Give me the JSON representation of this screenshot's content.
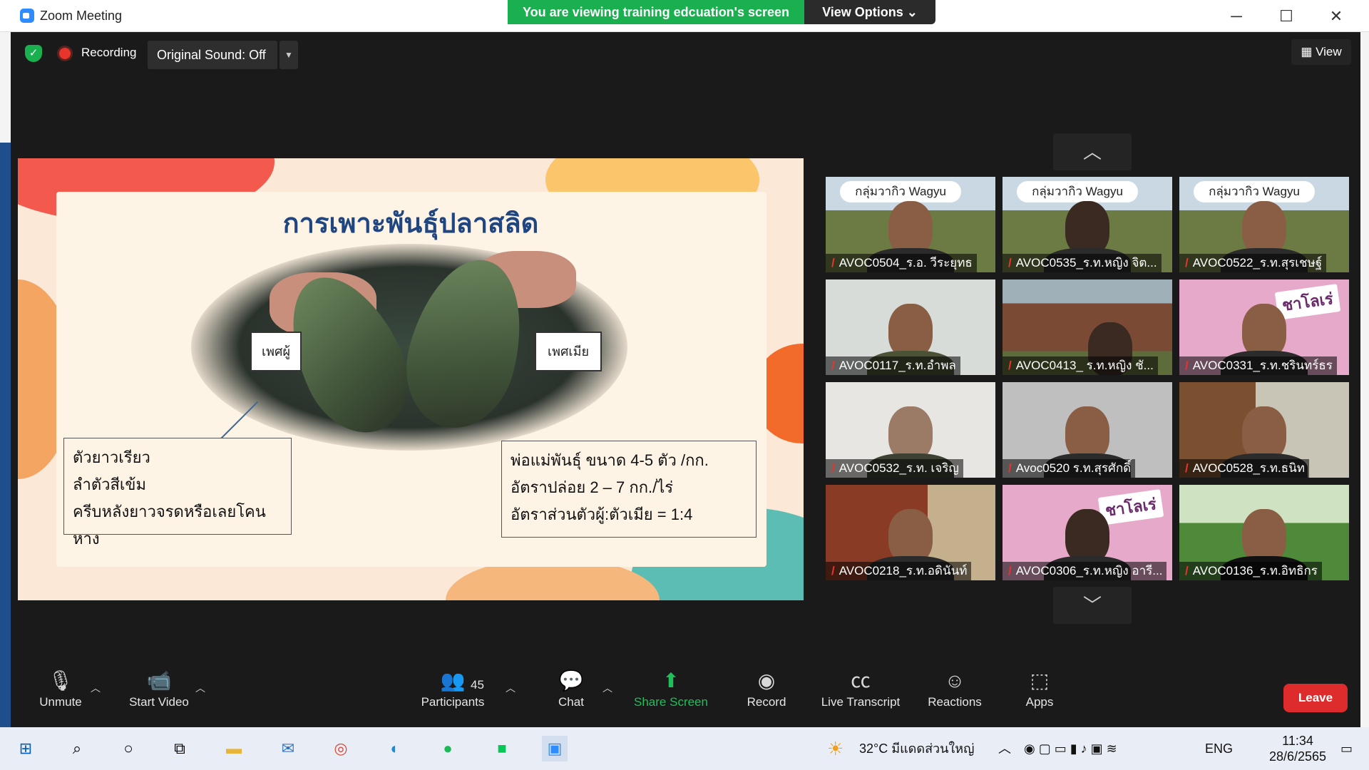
{
  "window": {
    "title": "Zoom Meeting",
    "minimize": "─",
    "maximize": "☐",
    "close": "✕"
  },
  "share": {
    "banner": "You are viewing training edcuation's screen",
    "view_options": "View Options ⌄"
  },
  "meeting_bar": {
    "recording": "Recording",
    "original_sound": "Original Sound: Off",
    "view": "View"
  },
  "slide": {
    "title": "การเพาะพันธุ์ปลาสลิด",
    "label_male": "เพศผู้",
    "label_female": "เพศเมีย",
    "left_lines": [
      "ตัวยาวเรียว",
      "ลำตัวสีเข้ม",
      "ครีบหลังยาวจรดหรือเลยโคนหาง"
    ],
    "right_lines": [
      "พ่อแม่พันธุ์ ขนาด 4-5 ตัว /กก.",
      "อัตราปล่อย 2 – 7 กก./ไร่",
      "อัตราส่วนตัวผู้:ตัวเมีย = 1:4"
    ]
  },
  "videos": [
    {
      "name": "AVOC0504_ร.อ. วีระยุทธ",
      "banner": "กลุ่มวากิว Wagyu"
    },
    {
      "name": "AVOC0535_ร.ท.หญิง จิต...",
      "banner": "กลุ่มวากิว Wagyu"
    },
    {
      "name": "AVOC0522_ร.ท.สุรเชษฐ์",
      "banner": "กลุ่มวากิว Wagyu"
    },
    {
      "name": "AVOC0117_ร.ท.อำพล",
      "banner": ""
    },
    {
      "name": "AVOC0413_ ร.ท.หญิง ชั...",
      "banner": ""
    },
    {
      "name": "AVOC0331_ร.ท.ชรินทร์ธร",
      "banner": "ชาโลเร่"
    },
    {
      "name": "AVOC0532_ร.ท. เจริญ",
      "banner": ""
    },
    {
      "name": "Avoc0520 ร.ท.สุรศักดิ์",
      "banner": ""
    },
    {
      "name": "AVOC0528_ร.ท.ธนิท",
      "banner": ""
    },
    {
      "name": "AVOC0218_ร.ท.อดินันท์",
      "banner": ""
    },
    {
      "name": "AVOC0306_ร.ท.หญิง อารี...",
      "banner": "ชาโลเร่"
    },
    {
      "name": "AVOC0136_ร.ท.อิทธิกร",
      "banner": ""
    }
  ],
  "toolbar": {
    "unmute": "Unmute",
    "start_video": "Start Video",
    "participants": "Participants",
    "participant_count": "45",
    "chat": "Chat",
    "share_screen": "Share Screen",
    "record": "Record",
    "live_transcript": "Live Transcript",
    "reactions": "Reactions",
    "apps": "Apps",
    "leave": "Leave"
  },
  "taskbar": {
    "weather": "32°C มีแดดส่วนใหญ่",
    "language": "ENG",
    "time": "11:34",
    "date": "28/6/2565"
  },
  "colors": {
    "zoom_blue": "#2d8cff",
    "share_green": "#1ab04f",
    "leave_red": "#de2b2b",
    "meeting_bg": "#1a1a1a",
    "slide_title": "#1f4680"
  }
}
